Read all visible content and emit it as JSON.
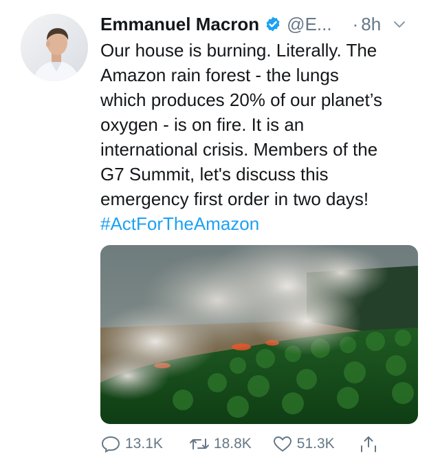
{
  "tweet": {
    "author": {
      "display_name": "Emmanuel Macron",
      "handle": "@E...",
      "verified": true,
      "verified_icon": "verified-badge-icon",
      "avatar": "avatar-photo"
    },
    "separator": "·",
    "timestamp": "8h",
    "text_lines": [
      "Our house is burning. Literally. The",
      "Amazon rain forest - the lungs",
      "which produces 20% of our planet’s",
      "oxygen - is on fire. It is an",
      "international crisis. Members of the",
      "G7 Summit, let's discuss this",
      "emergency first order in two days!"
    ],
    "hashtag": "#ActForTheAmazon",
    "actions": {
      "reply_count": "13.1K",
      "retweet_count": "18.8K",
      "like_count": "51.3K"
    }
  },
  "colors": {
    "text": "#14171a",
    "muted": "#657786",
    "link": "#1da1f2",
    "verified": "#1da1f2"
  }
}
